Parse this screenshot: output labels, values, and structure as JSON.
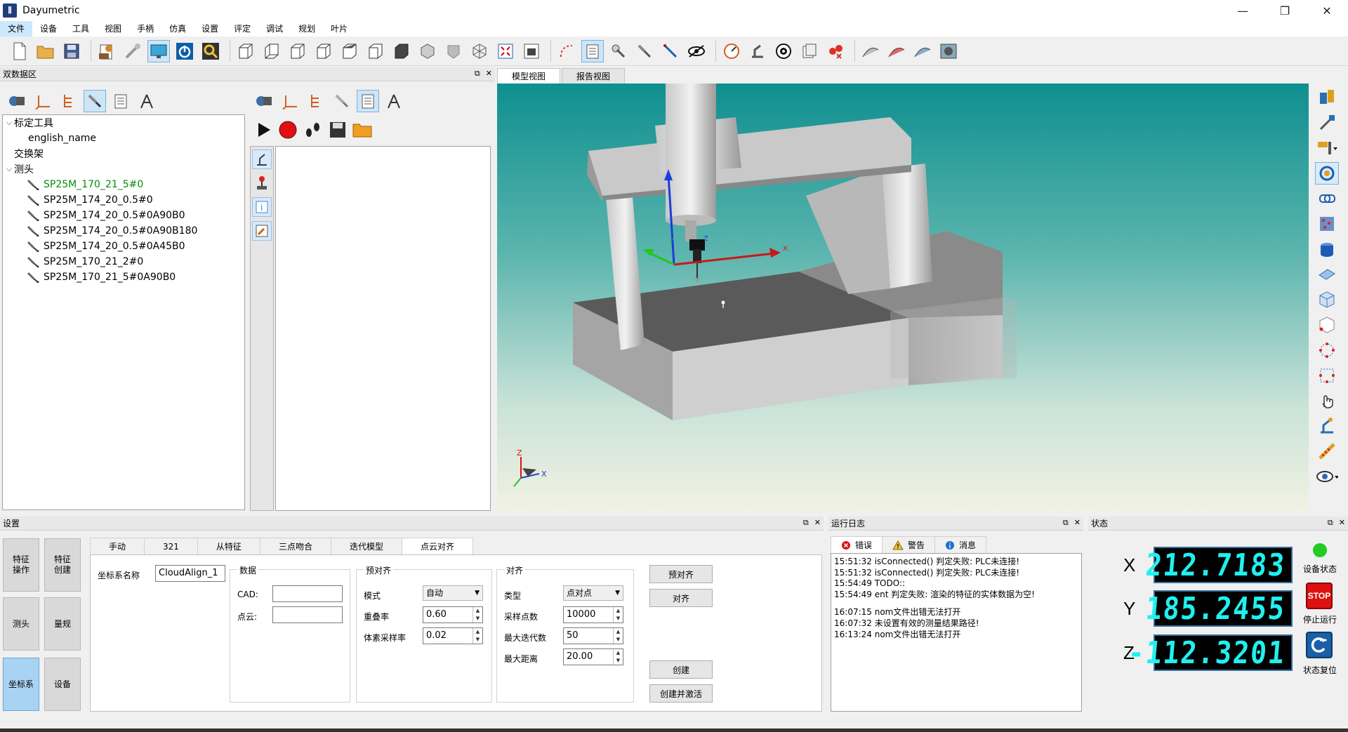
{
  "app": {
    "title": "Dayumetric"
  },
  "window": {
    "minimize": "—",
    "maximize": "❐",
    "close": "✕"
  },
  "menu": [
    "文件",
    "设备",
    "工具",
    "视图",
    "手柄",
    "仿真",
    "设置",
    "评定",
    "调试",
    "规划",
    "叶片"
  ],
  "toolbar_icons": [
    "new-file",
    "open-folder",
    "save",
    "settings-report",
    "connect",
    "monitor",
    "power",
    "search",
    "view-front",
    "view-back",
    "view-left",
    "view-right",
    "view-top",
    "view-bottom",
    "view-iso-solid",
    "view-shaded",
    "view-hidden",
    "view-wire",
    "view-fit",
    "snapshot",
    "path",
    "note",
    "probe-tool",
    "measure-line",
    "eye",
    "gauge",
    "arm",
    "target",
    "copy-sheet",
    "points",
    "blade-a",
    "blade-b",
    "blade-c",
    "blade-d"
  ],
  "left_panel": {
    "title": "双数据区",
    "tree": [
      {
        "label": "标定工具",
        "level": 0,
        "expanded": true
      },
      {
        "label": "english_name",
        "level": 1
      },
      {
        "label": "交换架",
        "level": 0
      },
      {
        "label": "测头",
        "level": 0,
        "expanded": true
      },
      {
        "label": "SP25M_170_21_5#0",
        "level": 1,
        "probe": true,
        "active": true
      },
      {
        "label": "SP25M_174_20_0.5#0",
        "level": 1,
        "probe": true
      },
      {
        "label": "SP25M_174_20_0.5#0A90B0",
        "level": 1,
        "probe": true
      },
      {
        "label": "SP25M_174_20_0.5#0A90B180",
        "level": 1,
        "probe": true
      },
      {
        "label": "SP25M_174_20_0.5#0A45B0",
        "level": 1,
        "probe": true
      },
      {
        "label": "SP25M_170_21_2#0",
        "level": 1,
        "probe": true
      },
      {
        "label": "SP25M_170_21_5#0A90B0",
        "level": 1,
        "probe": true
      }
    ]
  },
  "view_tabs": [
    "模型视图",
    "报告视图"
  ],
  "axis_labels": {
    "x": "X",
    "y": "Y",
    "z": "Z"
  },
  "settings": {
    "title": "设置",
    "nav": [
      "特征\n操作",
      "特征\n创建",
      "测头",
      "量规",
      "坐标系",
      "设备"
    ],
    "tabs": [
      "手动",
      "321",
      "从特征",
      "三点吻合",
      "迭代模型",
      "点云对齐"
    ],
    "cs_name_label": "坐标系名称",
    "cs_name_value": "CloudAlign_1",
    "data_group": {
      "title": "数据",
      "cad_label": "CAD:",
      "cloud_label": "点云:"
    },
    "prealign_group": {
      "title": "预对齐",
      "mode_label": "模式",
      "mode_value": "自动",
      "overlap_label": "重叠率",
      "overlap_value": "0.60",
      "voxel_label": "体素采样率",
      "voxel_value": "0.02"
    },
    "align_group": {
      "title": "对齐",
      "type_label": "类型",
      "type_value": "点对点",
      "samples_label": "采样点数",
      "samples_value": "10000",
      "iter_label": "最大迭代数",
      "iter_value": "50",
      "dist_label": "最大距离",
      "dist_value": "20.00"
    },
    "buttons": {
      "prealign": "预对齐",
      "align": "对齐",
      "create": "创建",
      "create_activate": "创建并激活"
    }
  },
  "log": {
    "title": "运行日志",
    "tabs": [
      "错误",
      "警告",
      "消息"
    ],
    "lines": [
      "15:51:32 isConnected() 判定失败: PLC未连接!",
      "15:51:32 isConnected() 判定失败: PLC未连接!",
      "15:54:49 TODO::",
      "15:54:49 ent 判定失败: 渲染的特征的实体数据为空!",
      "",
      "16:07:15 nom文件出错无法打开",
      "16:07:32 未设置有效的测量结果路径!",
      "16:13:24 nom文件出错无法打开"
    ]
  },
  "status": {
    "title": "状态",
    "x_label": "X",
    "x_value": "212.7183",
    "y_label": "Y",
    "y_value": "185.2455",
    "z_label": "Z",
    "z_value": "-112.3201",
    "device_state": "设备状态",
    "stop_label": "停止运行",
    "stop_badge": "STOP",
    "reset_label": "状态复位",
    "device_state_color": "#22cc22"
  },
  "colors": {
    "accent": "#cce8ff",
    "lcd_text": "#20f0f0",
    "probe_active": "#0a8a0a"
  }
}
